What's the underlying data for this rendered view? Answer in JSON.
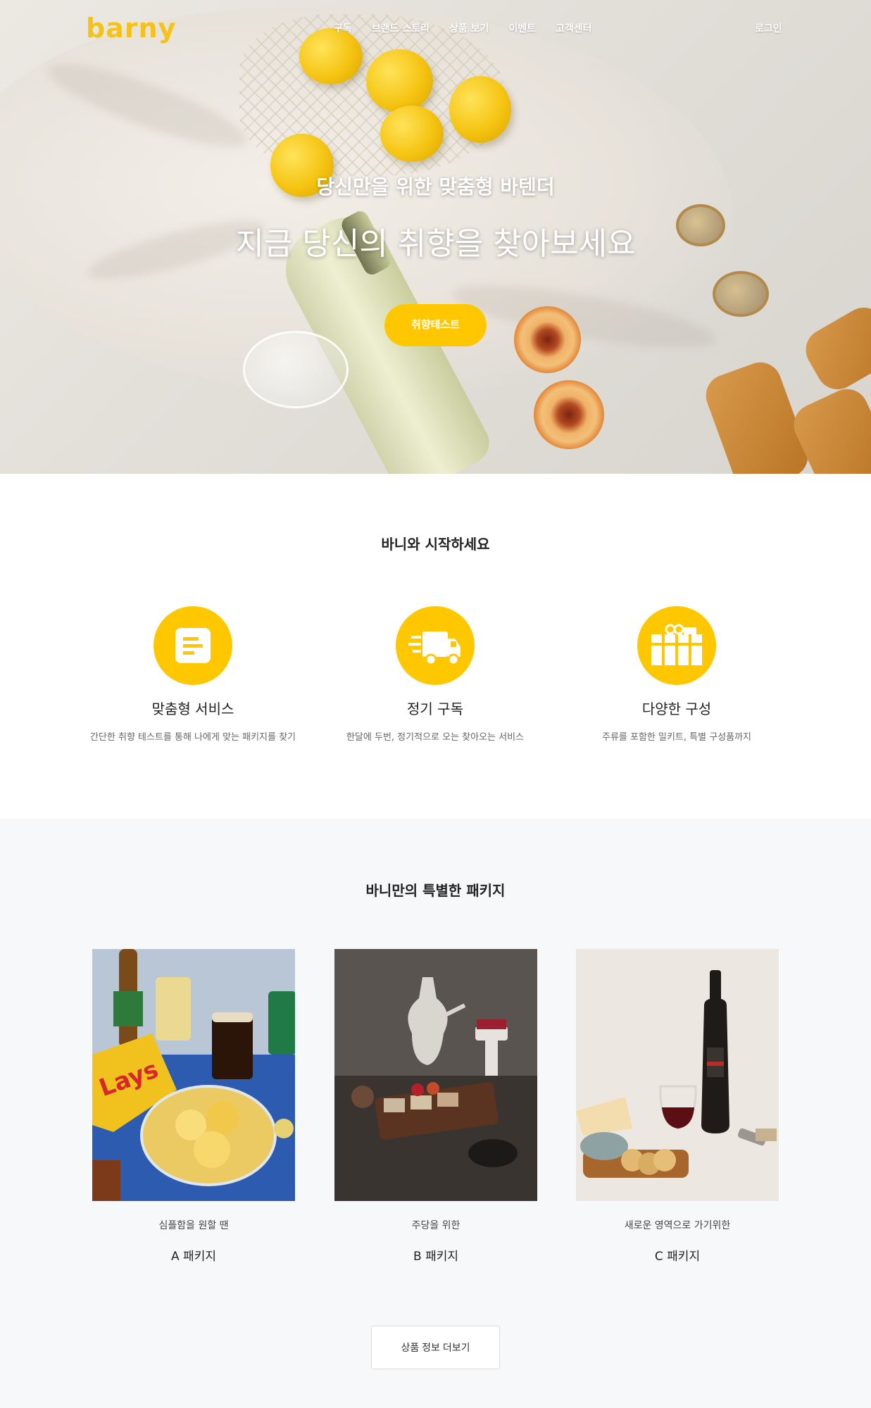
{
  "brand": {
    "logo": "barny",
    "accent_color": "#ffc700"
  },
  "nav": {
    "items": [
      "구독",
      "브랜드 스토리",
      "상품 보기",
      "이벤트",
      "고객센터"
    ],
    "login": "로그인"
  },
  "hero": {
    "subtitle": "당신만을 위한 맞춤형 바텐더",
    "title": "지금 당신의 취향을 찾아보세요",
    "cta": "취향테스트"
  },
  "start": {
    "title": "바니와 시작하세요",
    "features": [
      {
        "icon": "document-icon",
        "name": "맞춤형 서비스",
        "desc": "간단한 취향 테스트를 통해 나에게 맞는 패키지를 찾기"
      },
      {
        "icon": "truck-icon",
        "name": "정기 구독",
        "desc": "한달에 두번, 정기적으로 오는 찾아오는 서비스"
      },
      {
        "icon": "gift-icon",
        "name": "다양한 구성",
        "desc": "주류를 포함한 밀키트, 특별 구성품까지"
      }
    ]
  },
  "packages": {
    "title": "바니만의 특별한 패키지",
    "items": [
      {
        "desc": "심플함을 원할 땐",
        "name": "A 패키지"
      },
      {
        "desc": "주당을 위한",
        "name": "B 패키지"
      },
      {
        "desc": "새로운 영역으로 가기위한",
        "name": "C 패키지"
      }
    ],
    "more": "상품 정보 더보기"
  }
}
